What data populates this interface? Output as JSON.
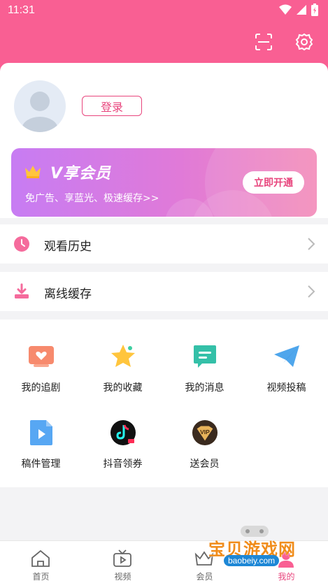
{
  "status_bar": {
    "time": "11:31"
  },
  "header": {
    "scan_icon": "scan-icon",
    "settings_icon": "gear-icon"
  },
  "profile": {
    "login_label": "登录"
  },
  "vip_banner": {
    "title": "V享会员",
    "subtitle": "免广告、享蓝光、极速缓存>>",
    "button_label": "立即开通"
  },
  "menu_rows": [
    {
      "label": "观看历史",
      "icon": "clock-icon"
    },
    {
      "label": "离线缓存",
      "icon": "download-icon"
    }
  ],
  "grid_items": [
    {
      "label": "我的追剧",
      "icon": "heart-tv-icon"
    },
    {
      "label": "我的收藏",
      "icon": "star-icon"
    },
    {
      "label": "我的消息",
      "icon": "message-icon"
    },
    {
      "label": "视频投稿",
      "icon": "paper-plane-icon"
    },
    {
      "label": "稿件管理",
      "icon": "video-file-icon"
    },
    {
      "label": "抖音领券",
      "icon": "tiktok-icon"
    },
    {
      "label": "送会员",
      "icon": "vip-badge-icon"
    }
  ],
  "tabs": [
    {
      "label": "首页",
      "icon": "home-icon",
      "active": false
    },
    {
      "label": "视频",
      "icon": "tv-play-icon",
      "active": false
    },
    {
      "label": "会员",
      "icon": "crown-icon",
      "active": false
    },
    {
      "label": "我的",
      "icon": "profile-icon",
      "active": true
    }
  ],
  "watermark": {
    "text": "宝贝游戏网",
    "url": "baobeiy.com"
  },
  "colors": {
    "accent": "#f95f93",
    "brand_text": "#e8457d",
    "vip_gradient_start": "#c77cf3",
    "vip_gradient_end": "#f38bb8"
  }
}
